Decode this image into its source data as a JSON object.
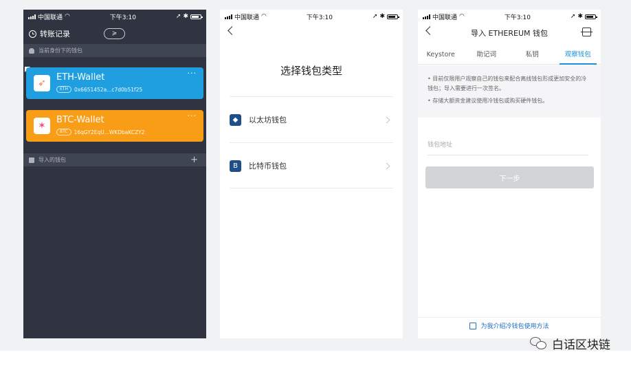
{
  "statusbar": {
    "carrier": "中国联通",
    "time": "下午3:10",
    "signal_icon": "signal-icon",
    "wifi_icon": "wifi-icon",
    "battery_icon": "battery-icon"
  },
  "phone1": {
    "header_title": "转账记录",
    "switch_glyph": "≽",
    "section_identity": "当前身份下的钱包",
    "section_imported": "导入的钱包",
    "add_glyph": "+",
    "wallets": [
      {
        "name": "ETH-Wallet",
        "tag": "ETH",
        "address": "0x6651452a...c7d0b51f25",
        "color": "#1f9fe0",
        "more": "···"
      },
      {
        "name": "BTC-Wallet",
        "tag": "BTC",
        "address": "16qGY2EqU...WKDbaKCZY2",
        "color": "#f99c16",
        "more": "···"
      }
    ],
    "background": "#2f3440"
  },
  "phone2": {
    "title": "选择钱包类型",
    "types": [
      {
        "icon_glyph": "◆",
        "label": "以太坊钱包"
      },
      {
        "icon_glyph": "B",
        "label": "比特币钱包"
      }
    ]
  },
  "phone3": {
    "title": "导入 ETHEREUM 钱包",
    "tabs": [
      "Keystore",
      "助记词",
      "私钥",
      "观察钱包"
    ],
    "active_tab": "观察钱包",
    "notice": [
      "• 目前仅限用户观察自己的钱包来配合离线钱包形成更加安全的冷钱包；导入需要进行一次签名。",
      "• 存储大额资金建议使用冷钱包或购买硬件钱包。"
    ],
    "address_placeholder": "钱包地址",
    "next_label": "下一步",
    "help_link": "为我介绍冷钱包使用方法",
    "accent": "#1b8fd9"
  },
  "watermark": {
    "text": "白话区块链"
  }
}
